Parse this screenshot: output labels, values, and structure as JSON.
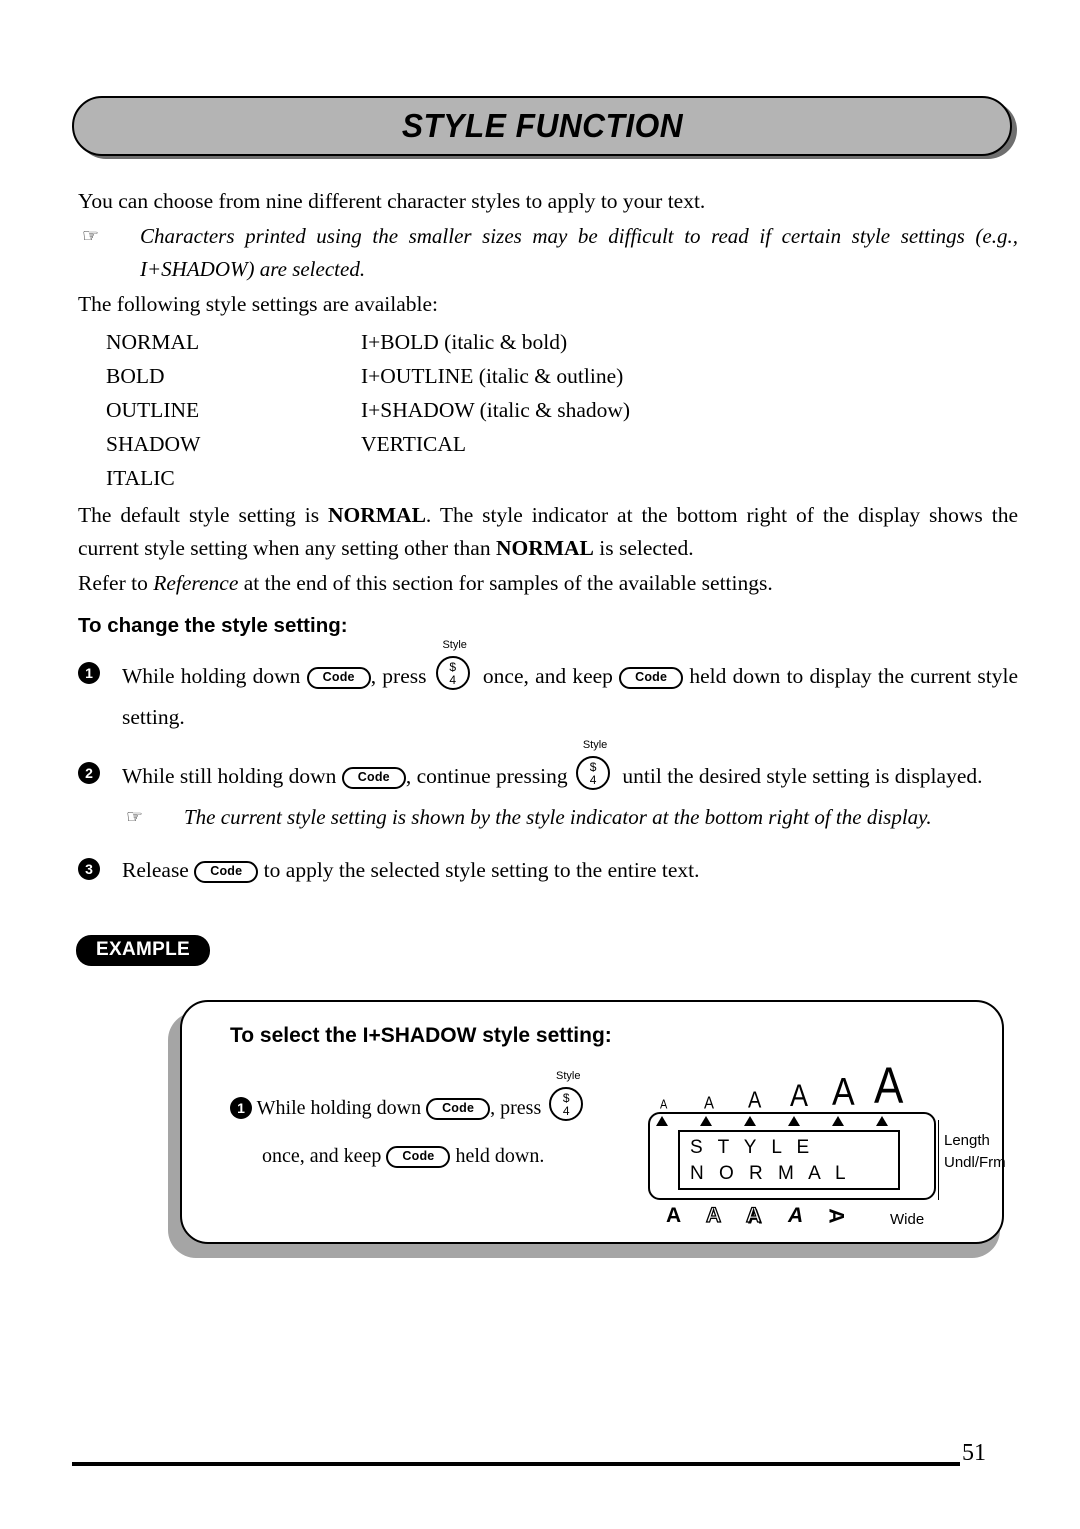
{
  "header": {
    "title": "STYLE FUNCTION"
  },
  "intro": {
    "line1": "You can choose from nine different character styles to apply to your text.",
    "note_icon": "☞",
    "note": "Characters printed using the smaller sizes may be difficult to read if certain style settings (e.g., I+SHADOW) are selected.",
    "line2": "The following style settings are available:"
  },
  "style_list": [
    {
      "left": "NORMAL",
      "right": "I+BOLD (italic & bold)"
    },
    {
      "left": "BOLD",
      "right": "I+OUTLINE (italic & outline)"
    },
    {
      "left": "OUTLINE",
      "right": "I+SHADOW (italic & shadow)"
    },
    {
      "left": "SHADOW",
      "right": "VERTICAL"
    },
    {
      "left": "ITALIC",
      "right": ""
    }
  ],
  "default_para": {
    "part1": "The default style setting is ",
    "bold1": "NORMAL",
    "part2": ". The style indicator at the bottom right of the display shows the current style setting when any setting other than ",
    "bold2": "NORMAL",
    "part3": " is selected."
  },
  "refer_para": {
    "part1": "Refer to ",
    "italic": "Reference",
    "part2": " at the end of this section for samples of the available settings."
  },
  "procedure_heading": "To change the style setting:",
  "steps": [
    {
      "num": "1",
      "t1": "While holding down ",
      "key1": "Code",
      "t2": ", press ",
      "key2_label": "Style",
      "key2_top": "$",
      "key2_bottom": "4",
      "t3": " once, and keep ",
      "key3": "Code",
      "t4": " held down to display the current style setting."
    },
    {
      "num": "2",
      "t1": "While still holding down ",
      "key1": "Code",
      "t2": ", continue pressing ",
      "key2_label": "Style",
      "key2_top": "$",
      "key2_bottom": "4",
      "t3": " until the desired style setting is displayed."
    },
    {
      "num": "3",
      "t1": "Release ",
      "key1": "Code",
      "t2": " to apply the selected style setting to the entire text."
    }
  ],
  "step2_note": {
    "icon": "☞",
    "text": "The current style setting is shown by the style indicator at the bottom right of the display."
  },
  "example": {
    "badge": "EXAMPLE",
    "title": "To select the I+SHADOW style setting:",
    "step_num": "1",
    "step_t1": "While holding down ",
    "step_key1": "Code",
    "step_t2": ", press ",
    "step_key2_label": "Style",
    "step_key2_top": "$",
    "step_key2_bottom": "4",
    "step_t3": "once, and keep ",
    "step_key3": "Code",
    "step_t4": " held down."
  },
  "lcd": {
    "size_indicators": [
      "A",
      "A",
      "A",
      "A",
      "A",
      "A"
    ],
    "screen_line1": "S T Y L E",
    "screen_line2": "N O R M A L",
    "style_indicators": [
      {
        "glyph": "A",
        "name": "bold-indicator"
      },
      {
        "glyph": "A",
        "name": "outline-indicator"
      },
      {
        "glyph": "A",
        "name": "shadow-indicator"
      },
      {
        "glyph": "A",
        "name": "italic-indicator"
      },
      {
        "glyph": "A",
        "name": "vertical-indicator"
      }
    ],
    "wide_label": "Wide",
    "right_label1": "Length",
    "right_label2": "Undl/Frm"
  },
  "footer": {
    "page_number": "51"
  }
}
